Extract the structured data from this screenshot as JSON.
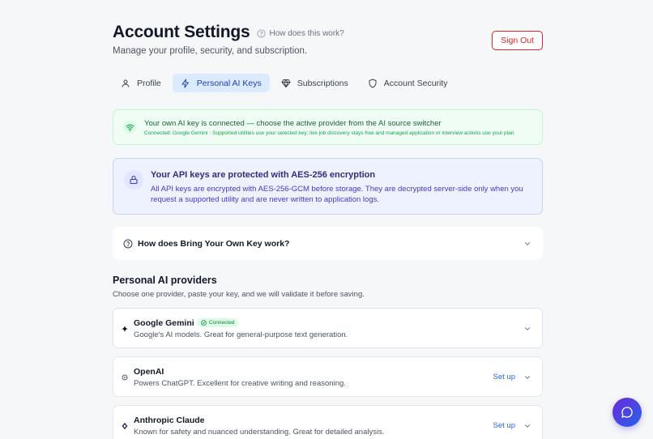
{
  "header": {
    "title": "Account Settings",
    "help_link": "How does this work?",
    "subtitle": "Manage your profile, security, and subscription.",
    "sign_out": "Sign Out"
  },
  "tabs": [
    {
      "label": "Profile",
      "icon": "user-icon",
      "active": false
    },
    {
      "label": "Personal AI Keys",
      "icon": "lightning-icon",
      "active": true
    },
    {
      "label": "Subscriptions",
      "icon": "diamond-icon",
      "active": false
    },
    {
      "label": "Account Security",
      "icon": "shield-icon",
      "active": false
    }
  ],
  "connected_banner": {
    "message": "Your own AI key is connected — choose the active provider from the AI source switcher",
    "detail": "Connected: Google Gemini · Supported utilities use your selected key; live job discovery stays free and managed application or interview actions use your plan"
  },
  "security_notice": {
    "title": "Your API keys are protected with AES-256 encryption",
    "body": "All API keys are encrypted with AES-256-GCM before storage. They are decrypted server-side only when you request a supported utility and are never written to application logs."
  },
  "byok": {
    "label": "How does Bring Your Own Key work?"
  },
  "providers_section": {
    "title": "Personal AI providers",
    "subtitle": "Choose one provider, paste your key, and we will validate it before saving."
  },
  "providers": [
    {
      "name": "Google Gemini",
      "description": "Google's AI models. Great for general-purpose text generation.",
      "badge": "Connected",
      "action": ""
    },
    {
      "name": "OpenAI",
      "description": "Powers ChatGPT. Excellent for creative writing and reasoning.",
      "badge": "",
      "action": "Set up"
    },
    {
      "name": "Anthropic Claude",
      "description": "Known for safety and nuanced understanding. Great for detailed analysis.",
      "badge": "",
      "action": "Set up"
    }
  ],
  "colors": {
    "accent": "#2563eb",
    "danger": "#dc2626",
    "success": "#16a34a",
    "indigo": "#4338ca"
  }
}
